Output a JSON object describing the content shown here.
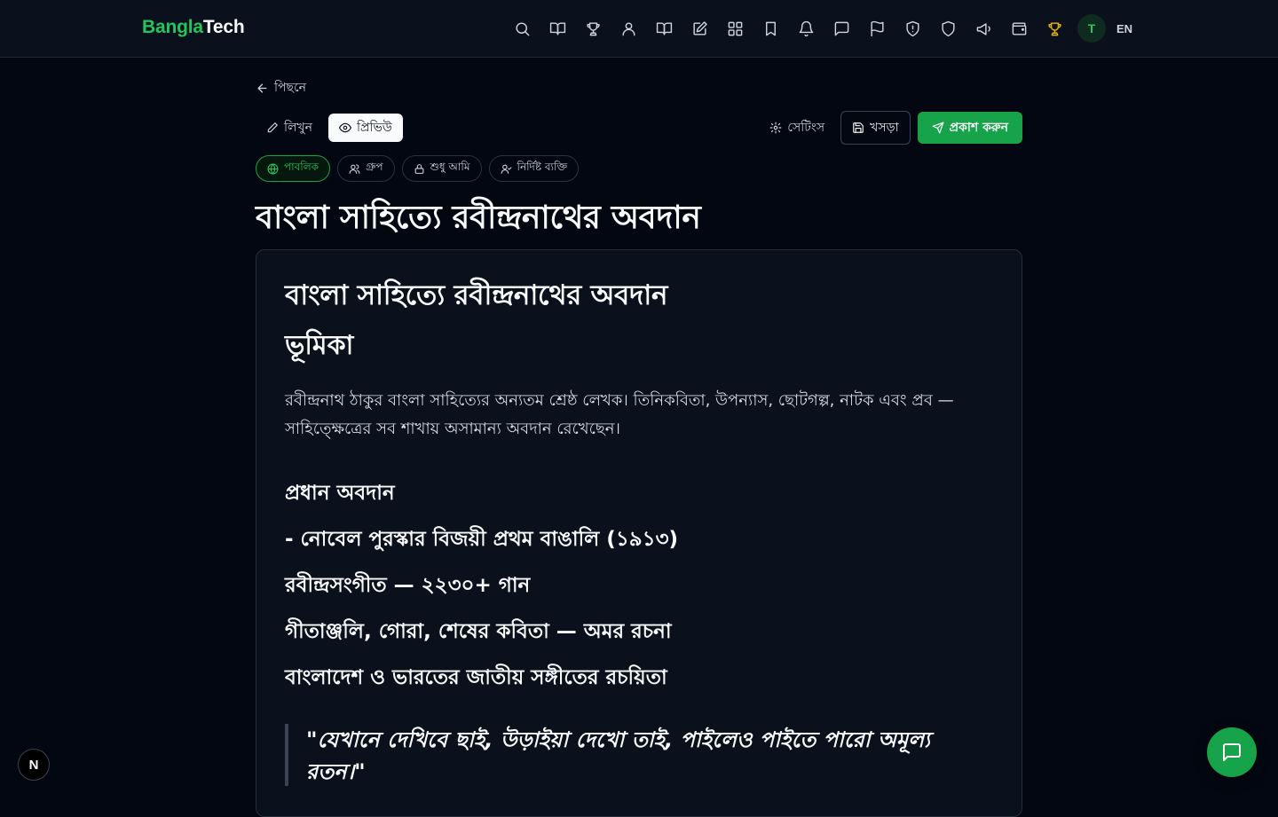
{
  "brand": {
    "part1": "Bangla",
    "part2": "Tech"
  },
  "nav": {
    "icons": [
      "search-icon",
      "book-open-icon",
      "trophy-icon",
      "users-icon",
      "book-open-icon",
      "edit-icon",
      "grid-icon",
      "bookmark-icon",
      "bell-icon",
      "message-icon",
      "flag-icon",
      "shield-alert-icon",
      "shield-icon",
      "megaphone-icon",
      "wallet-icon",
      "trophy-gold-icon"
    ],
    "avatar_initial": "T",
    "language": "EN"
  },
  "back_label": "পিছনে",
  "mode_tabs": {
    "write": "লিখুন",
    "preview": "প্রিভিউ"
  },
  "actions": {
    "settings": "সেটিংস",
    "draft": "খসড়া",
    "publish": "প্রকাশ করুন"
  },
  "visibility": {
    "public": "পাবলিক",
    "group": "গ্রুপ",
    "only_me": "শুধু আমি",
    "specific": "নির্দিষ্ট ব্যক্তি",
    "selected": "public"
  },
  "post_title": "বাংলা সাহিত্যে রবীন্দ্রনাথের অবদান",
  "preview": {
    "h1": "বাংলা সাহিত্যে রবীন্দ্রনাথের অবদান",
    "h2": "ভূমিকা",
    "paragraph": "রবীন্দ্রনাথ ঠাকুর বাংলা সাহিত্যের অন্যতম শ্রেষ্ঠ লেখক। তিনিকবিতা, উপন্যাস, ছোটগল্প, নাটক এবং প্রব — সাহিত্ক্ষেত্রের সব শাখায় অসামান্য অবদান রেখেছেন।",
    "h3": "প্রধান অবদান",
    "items": [
      "- নোবেল পুরস্কার বিজয়ী প্রথম বাঙালি (১৯১৩)",
      "রবীন্দ্রসংগীত — ২২৩০+ গান",
      "গীতাঞ্জলি, গোরা, শেষের কবিতা — অমর রচনা",
      "বাংলাদেশ ও ভারতের জাতীয় সঙ্গীতের রচয়িতা"
    ],
    "quote": "\"যেখানে দেখিবে ছাই, উড়াইয়া দেখো তাই, পাইলেও পাইতে পারো অমূল্য রতন।\""
  },
  "floating": {
    "next_badge": "N"
  },
  "colors": {
    "accent": "#16a34a",
    "accent_text": "#22c55e",
    "gold": "#eab308",
    "background": "#030711"
  }
}
